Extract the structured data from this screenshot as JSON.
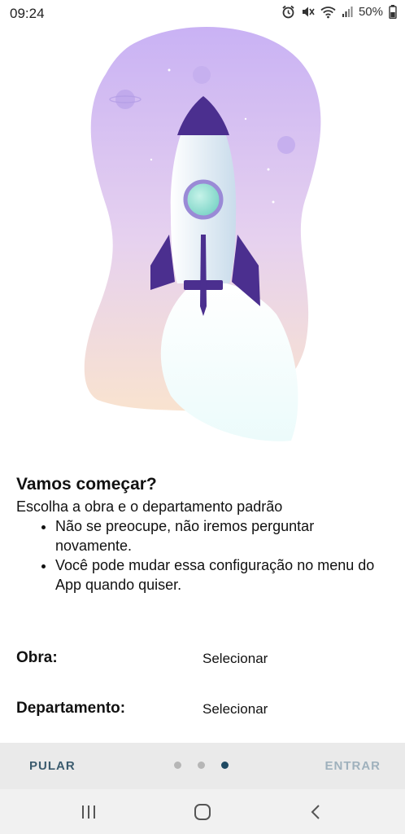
{
  "status_bar": {
    "time": "09:24",
    "battery": "50%",
    "icons": [
      "alarm-icon",
      "mute-icon",
      "wifi-icon",
      "signal-icon",
      "battery-icon"
    ]
  },
  "onboarding": {
    "title": "Vamos começar?",
    "subtitle": "Escolha a obra e o departamento padrão",
    "bullets": [
      "Não se preocupe, não iremos perguntar novamente.",
      "Você pode mudar essa configuração no menu do App quando quiser."
    ]
  },
  "fields": {
    "obra": {
      "label": "Obra:",
      "value": "Selecionar"
    },
    "departamento": {
      "label": "Departamento:",
      "value": "Selecionar"
    }
  },
  "footer": {
    "skip_label": "PULAR",
    "enter_label": "ENTRAR",
    "page_count": 3,
    "active_page": 3
  },
  "nav": {
    "icons": [
      "recent-apps-icon",
      "home-icon",
      "back-icon"
    ]
  },
  "colors": {
    "primary": "#1f4a63",
    "rocket_purple": "#4b2f8f",
    "bg_purple": "#cdb8f3",
    "bg_peach": "#f8dfcf"
  }
}
